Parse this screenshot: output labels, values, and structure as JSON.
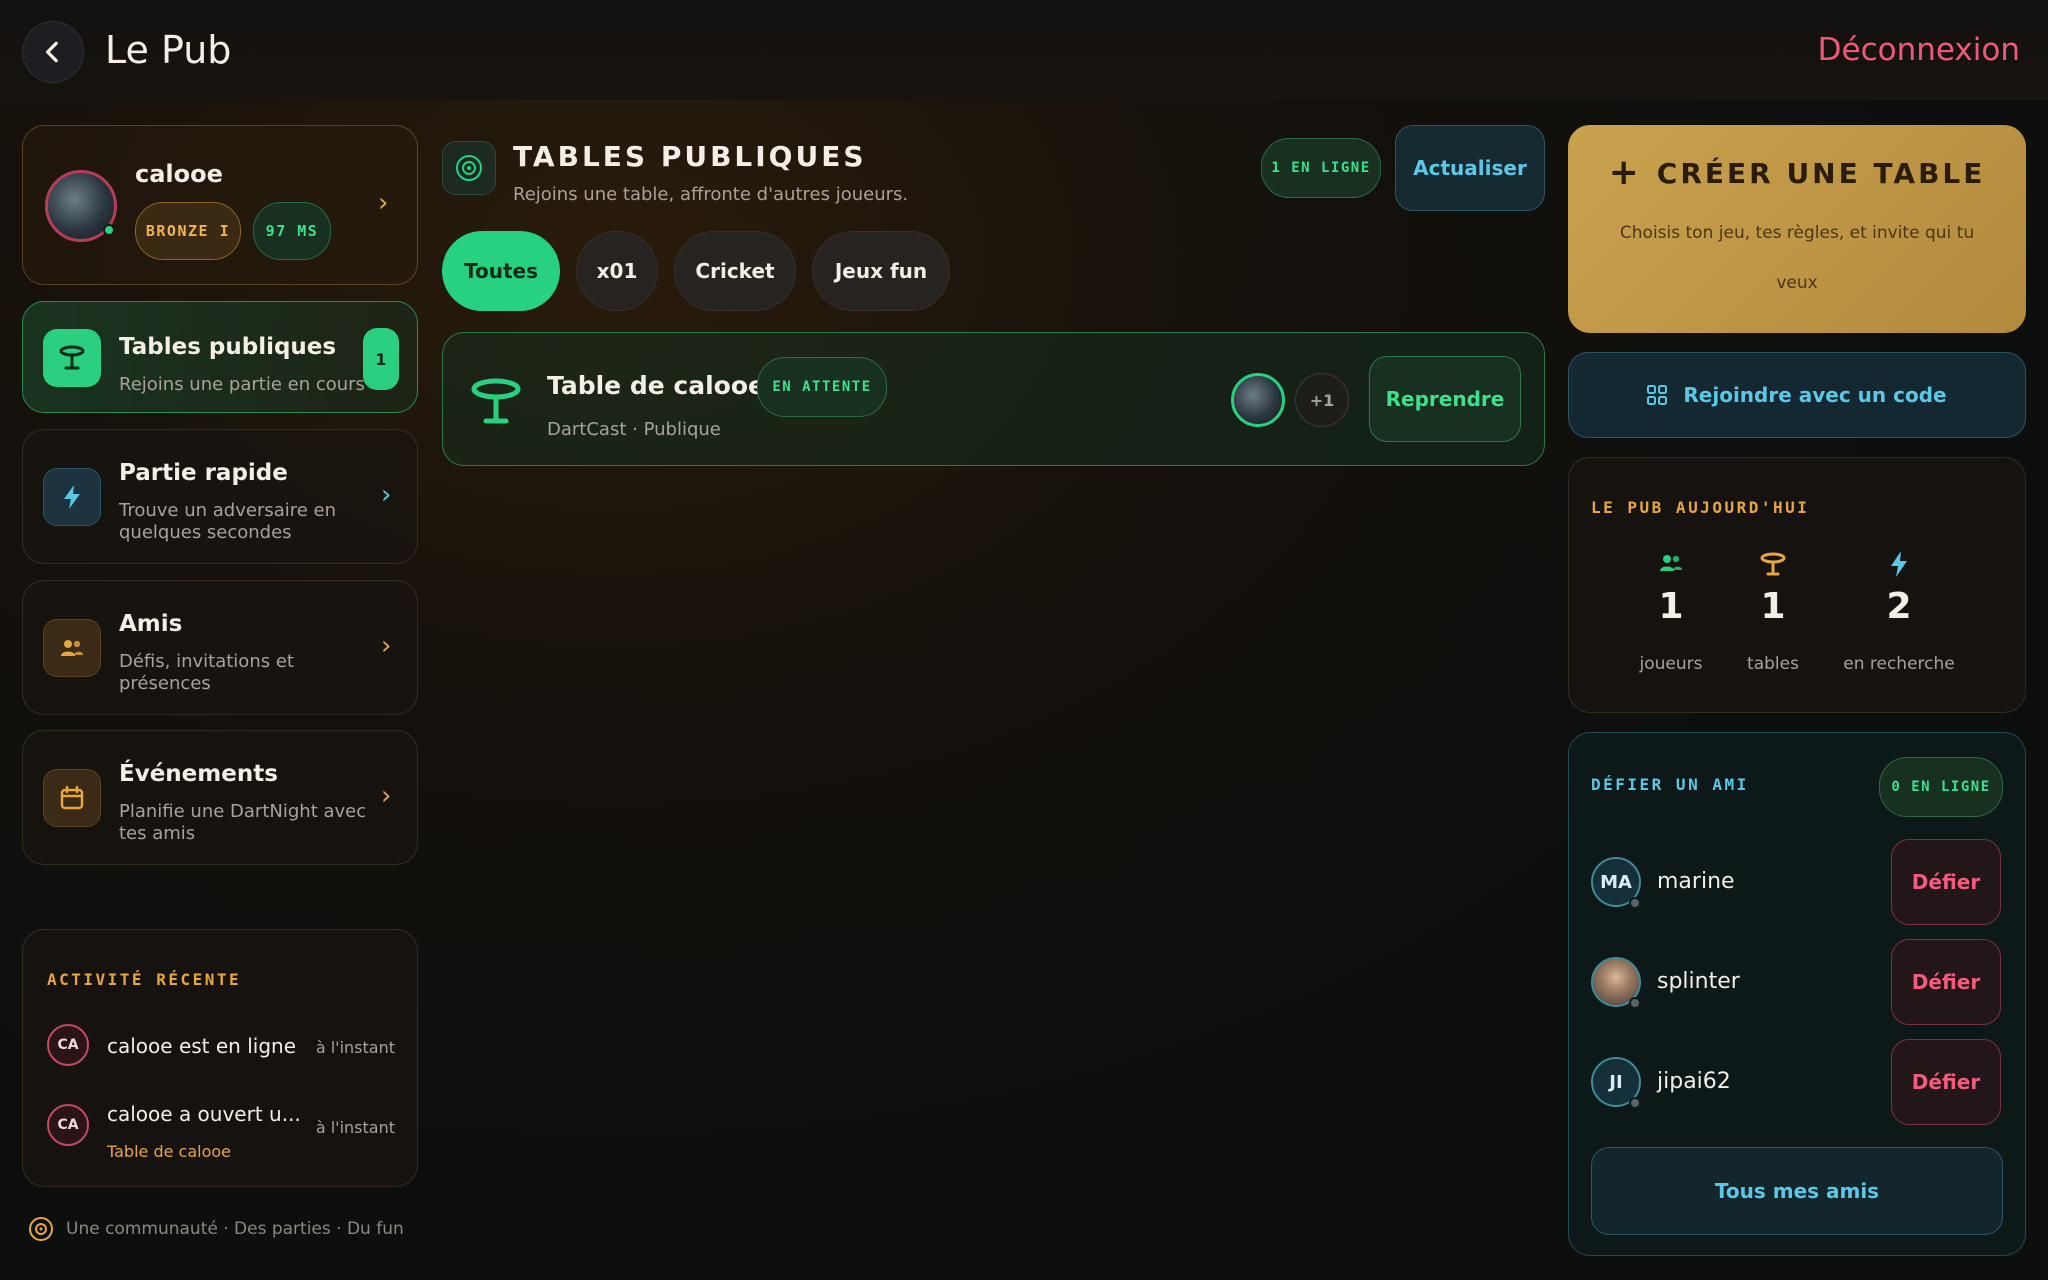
{
  "header": {
    "title": "Le Pub",
    "logout_label": "Déconnexion"
  },
  "profile": {
    "username": "calooe",
    "rank_badge": "BRONZE I",
    "ping_badge": "97 MS"
  },
  "sidebar": {
    "items": [
      {
        "title": "Tables publiques",
        "subtitle": "Rejoins une partie en cours",
        "count": "1"
      },
      {
        "title": "Partie rapide",
        "subtitle_line1": "Trouve un adversaire en",
        "subtitle_line2": "quelques secondes"
      },
      {
        "title": "Amis",
        "subtitle_line1": "Défis, invitations et",
        "subtitle_line2": "présences"
      },
      {
        "title": "Événements",
        "subtitle_line1": "Planifie une DartNight avec",
        "subtitle_line2": "tes amis"
      }
    ]
  },
  "activity": {
    "label": "ACTIVITÉ RÉCENTE",
    "items": [
      {
        "initials": "CA",
        "text": "calooe est en ligne",
        "time": "à l'instant"
      },
      {
        "initials": "CA",
        "text": "calooe a ouvert u...",
        "link": "Table de calooe",
        "time": "à l'instant"
      }
    ]
  },
  "footer": {
    "tagline": "Une communauté · Des parties · Du fun"
  },
  "public_tables": {
    "title": "TABLES PUBLIQUES",
    "subtitle": "Rejoins une table, affronte d'autres joueurs.",
    "online_badge": "1 EN LIGNE",
    "refresh_label": "Actualiser",
    "filters": [
      "Toutes",
      "x01",
      "Cricket",
      "Jeux fun"
    ],
    "table": {
      "name": "Table de calooe",
      "status": "EN ATTENTE",
      "app": "DartCast",
      "visibility": "Publique",
      "extra_players": "+1",
      "action_label": "Reprendre"
    }
  },
  "create_table": {
    "title": "CRÉER UNE TABLE",
    "desc_line1": "Choisis ton jeu, tes règles, et invite qui tu",
    "desc_line2": "veux"
  },
  "join_code": {
    "label": "Rejoindre avec un code"
  },
  "pub_today": {
    "label": "LE PUB AUJOURD'HUI",
    "stats": [
      {
        "value": "1",
        "label": "joueurs"
      },
      {
        "value": "1",
        "label": "tables"
      },
      {
        "value": "2",
        "label": "en recherche"
      }
    ]
  },
  "challenge": {
    "label": "DÉFIER UN AMI",
    "online_badge": "0 EN LIGNE",
    "friends": [
      {
        "initials": "MA",
        "name": "marine",
        "action": "Défier"
      },
      {
        "initials": "",
        "name": "splinter",
        "action": "Défier"
      },
      {
        "initials": "JI",
        "name": "jipai62",
        "action": "Défier"
      }
    ],
    "all_friends_label": "Tous mes amis"
  },
  "colors": {
    "accent_green": "#27d17f",
    "accent_gold": "#e8a640",
    "accent_cyan": "#5cc8e8",
    "accent_red": "#f0587a"
  }
}
